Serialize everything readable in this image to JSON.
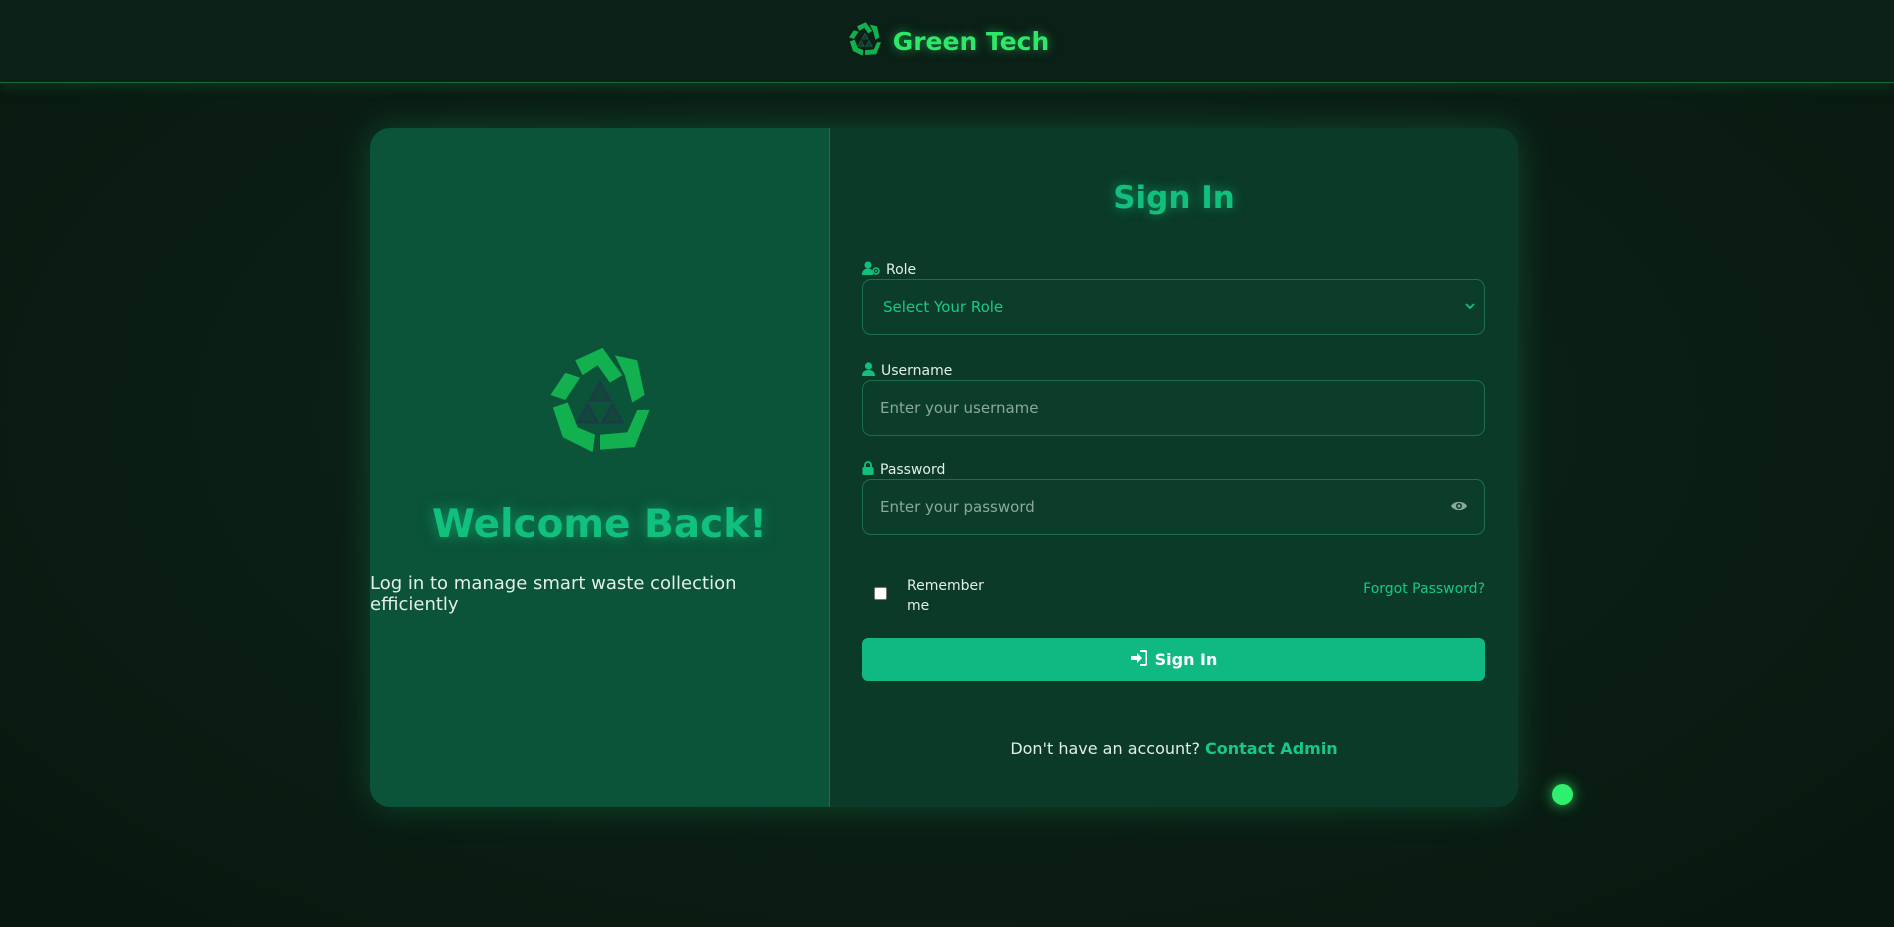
{
  "header": {
    "brand_title": "Green Tech",
    "logo_icon": "recycle-icon"
  },
  "welcome_panel": {
    "logo_icon": "recycle-icon",
    "heading": "Welcome Back!",
    "subtitle": "Log in to manage smart waste collection efficiently"
  },
  "form": {
    "heading": "Sign In",
    "role": {
      "icon": "user-gear-icon",
      "label": "Role",
      "selected": "Select Your Role"
    },
    "username": {
      "icon": "user-icon",
      "label": "Username",
      "placeholder": "Enter your username"
    },
    "password": {
      "icon": "lock-icon",
      "label": "Password",
      "placeholder": "Enter your password",
      "toggle_icon": "eye-icon"
    },
    "remember_label": "Remember me",
    "remember_checked": false,
    "forgot_label": "Forgot Password?",
    "submit_label": "Sign In",
    "submit_icon": "sign-in-icon",
    "footer_prompt": "Don't have an account?",
    "footer_link": "Contact Admin"
  },
  "colors": {
    "accent": "#10b981",
    "brand_green": "#2ee86a",
    "panel_left": "#0b5339",
    "panel_right": "#0b3a28"
  }
}
